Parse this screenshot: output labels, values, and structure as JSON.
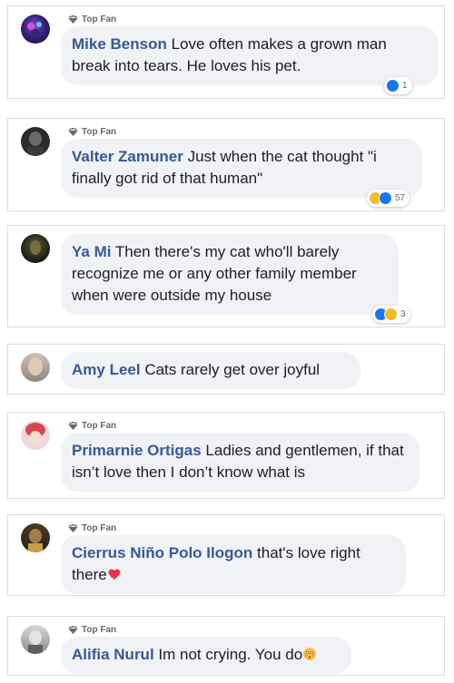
{
  "badge_label": "Top Fan",
  "colors": {
    "author": "#385898",
    "bubble": "#f0f2f5",
    "like": "#1877f2",
    "haha": "#f7b928"
  },
  "comments": [
    {
      "author": "Mike Benson",
      "text": "Love often makes a grown man break into tears. He loves his pet.",
      "top_fan": true,
      "reactions": [
        "like"
      ],
      "reaction_count": "1"
    },
    {
      "author": "Valter Zamuner",
      "text": "Just when the cat thought \"i finally got rid of that human\"",
      "top_fan": true,
      "reactions": [
        "haha",
        "like"
      ],
      "reaction_count": "57"
    },
    {
      "author": "Ya Mi",
      "text": "Then there's my cat who'll barely recognize me or any other family member when were outside my house",
      "top_fan": false,
      "reactions": [
        "like",
        "haha"
      ],
      "reaction_count": "3"
    },
    {
      "author": "Amy Leel",
      "text": "Cats rarely get over joyful",
      "top_fan": false
    },
    {
      "author": "Primarnie Ortigas",
      "text": "Ladies and gentlemen, if that isn’t love then I don’t know what is",
      "top_fan": true
    },
    {
      "author": "Cierrus Niño Polo Ilogon",
      "text": "that's love right there",
      "top_fan": true,
      "emoji": "heart-emoji"
    },
    {
      "author": "Alifia Nurul",
      "text": "Im not crying. You do",
      "top_fan": true,
      "emoji": "flushed-face-emoji"
    }
  ]
}
